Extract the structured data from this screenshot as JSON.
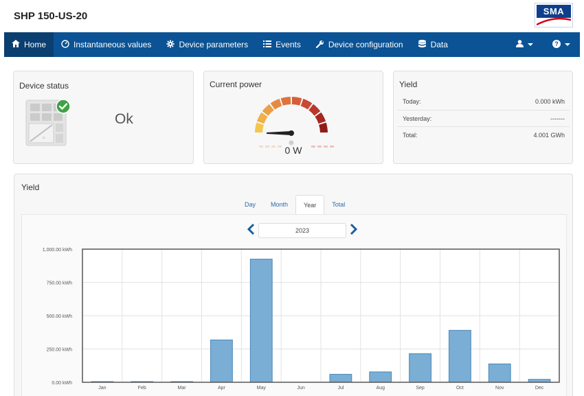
{
  "header": {
    "device_title": "SHP 150-US-20",
    "logo_text": "SMA"
  },
  "nav": {
    "items": [
      {
        "label": "Home",
        "icon": "home-icon",
        "active": true
      },
      {
        "label": "Instantaneous values",
        "icon": "gauge-icon",
        "active": false
      },
      {
        "label": "Device parameters",
        "icon": "gear-icon",
        "active": false
      },
      {
        "label": "Events",
        "icon": "list-icon",
        "active": false
      },
      {
        "label": "Device configuration",
        "icon": "wrench-icon",
        "active": false
      },
      {
        "label": "Data",
        "icon": "database-icon",
        "active": false
      }
    ],
    "user_icon": "user-icon",
    "help_icon": "help-icon"
  },
  "device_status": {
    "title": "Device status",
    "value": "Ok"
  },
  "current_power": {
    "title": "Current power",
    "value": "0 W",
    "fraction": 0
  },
  "yield_summary": {
    "title": "Yield",
    "rows": [
      {
        "label": "Today:",
        "value": "0.000 kWh"
      },
      {
        "label": "Yesterday:",
        "value": "-------"
      },
      {
        "label": "Total:",
        "value": "4.001 GWh"
      }
    ]
  },
  "yield_chart": {
    "title": "Yield",
    "tabs": [
      "Day",
      "Month",
      "Year",
      "Total"
    ],
    "active_tab": "Year",
    "year": "2023",
    "colors": {
      "bar": "#7aaed4",
      "bar_stroke": "#4a86b8"
    }
  },
  "chart_data": {
    "type": "bar",
    "categories": [
      "Jan",
      "Feb",
      "Mar",
      "Apr",
      "May",
      "Jun",
      "Jul",
      "Aug",
      "Sep",
      "Oct",
      "Nov",
      "Dec"
    ],
    "values": [
      2,
      2,
      2,
      318,
      925,
      0,
      60,
      78,
      215,
      390,
      138,
      22
    ],
    "ylabel": "",
    "y_ticks": [
      "0.00 kWh",
      "250.00 kWh",
      "500.00 kWh",
      "750.00 kWh",
      "1,000.00 kWh"
    ],
    "ylim": [
      0,
      1000
    ],
    "grid": true
  }
}
